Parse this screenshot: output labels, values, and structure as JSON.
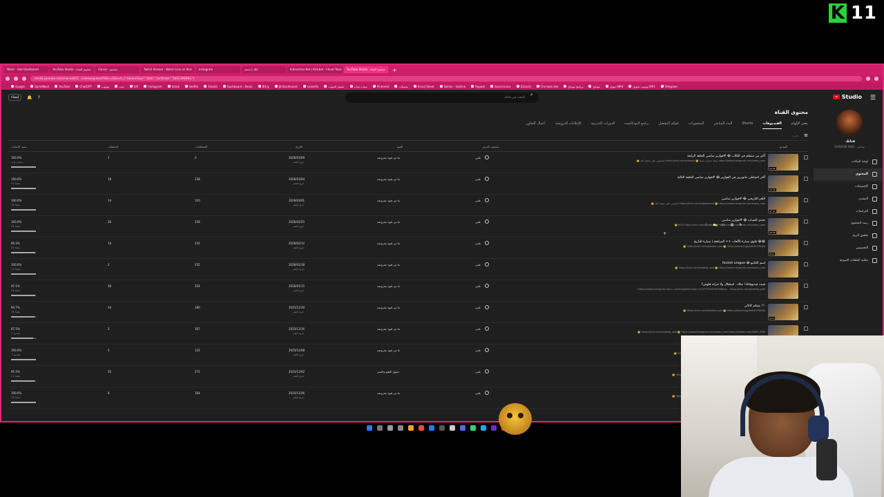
{
  "overlay": {
    "logo_letter": "K",
    "logo_number": "11"
  },
  "browser": {
    "tabs": [
      {
        "label": "Wizer - Slot Dashboard"
      },
      {
        "label": "YouTube Studio - محتوى القناة"
      },
      {
        "label": "Canva - تصاميم"
      },
      {
        "label": "Twitch Stream - Watch Live on Kick"
      },
      {
        "label": "Instagram"
      },
      {
        "label": "كلك | منصة"
      },
      {
        "label": "Interactive Bot | Kickbot - Cloud Tools"
      },
      {
        "label": "YouTube Studio - محتوى القناة"
      }
    ],
    "active_tab": 7,
    "new_tab": "+",
    "url": "studio.youtube.com/channel/UC.../videos/upload?filter=[]&sort={\"columnType\":\"date\",\"sortOrder\":\"DESCENDING\"}",
    "bookmarks": [
      "Google",
      "SprintNest",
      "YouTube",
      "ChatGPT",
      "يوتيوب",
      "بحث",
      "X/E",
      "Instagram",
      "tiktok",
      "Netflix",
      "Shahid",
      "Dashboard - Resto",
      "Bit.ly",
      "JB Dashboard",
      "Linkedin",
      "تحميل الصوت",
      "سناب شات",
      "Pinterest",
      "تحميلات",
      "Emoji Sheet",
      "Notion - Outline",
      "Repost",
      "Social Icons",
      "Discord",
      "The best site",
      "برنامج مونتاج",
      "مونتاج",
      "تحويل MP4",
      "يوتيوب تحويل MP3",
      "Telegram"
    ]
  },
  "studio": {
    "logo_text": "Studio",
    "search_placeholder": "البحث في قناتك",
    "create_label": "إنشاء",
    "page_title": "محتوى القناة",
    "tabs": [
      "بعض الإلهام",
      "الفيديوهات",
      "Shorts",
      "البث المباشر",
      "المنشورات",
      "قوائم التشغيل",
      "برامج البودكاست",
      "الدورات التدريبية",
      "الإعلانات الترويجية",
      "أعمال التعاون"
    ],
    "active_tab_index": 1,
    "filter_label": "فلترة",
    "columns": {
      "video": "الفيديو",
      "visibility": "مستوى العرض",
      "restrictions": "القيود",
      "date": "التاريخ",
      "views": "المشاهدات",
      "comments": "التعليقات",
      "likes": "نسبة الإعجاب"
    },
    "rows": [
      {
        "title": "أكثر من منتظم في الكلاب 😂 #فوازير ساسي الحلقة الرابعة",
        "desc": "👑 ادعموني على منصة كيك https://kick.com/shadow 👑 رابط حسابي انستا https://www.instagram.com/samy_swe",
        "duration": "22:22",
        "visibility": "علني",
        "restrictions": "ما من قيود مفروضة",
        "date": "2026/03/09",
        "date_sub": "تاريخ النشر",
        "views": "3",
        "comments": "1",
        "likes": "100.0%",
        "likes_sub": "معجب واحد",
        "likes_frac": 1.0
      },
      {
        "title": "أكثر احتياطي ماتويرين في الفوازير 😂 #فوازير ساسي الحلقة الثالثة",
        "desc": "",
        "duration": "43:20",
        "visibility": "علني",
        "restrictions": "ما من قيود مفروضة",
        "date": "2026/03/04",
        "date_sub": "تاريخ النشر",
        "views": "138",
        "comments": "18",
        "likes": "100.0%",
        "likes_sub": "31 معجبًا",
        "likes_frac": 1.0
      },
      {
        "title": "اللغز التاريخي 😂 #فوازير ساسي",
        "desc": "👑 ادعموني على منصة كيك https://kick.com/sakaemood 👑 https://www.instagram.com/samy_swe",
        "duration": "47:47",
        "visibility": "علني",
        "restrictions": "ما من قيود مفروضة",
        "date": "2026/03/01",
        "date_sub": "تاريخ النشر",
        "views": "120",
        "comments": "14",
        "likes": "100.0%",
        "likes_sub": "16 معجبًا",
        "likes_frac": 1.0
      },
      {
        "title": "تحدي الشباب 😂 #فوازير ساسي",
        "desc": "👑 KICK https://kick.com/shadow 👑 https://www.instagram.com/samy_swe",
        "duration": "49:09",
        "visibility": "علني",
        "restrictions": "ما من قيود مفروضة",
        "date": "2026/02/25",
        "date_sub": "تاريخ النشر",
        "views": "228",
        "comments": "26",
        "likes": "100.0%",
        "likes_sub": "32 معجبًا",
        "likes_frac": 1.0
      },
      {
        "title": "فلوق سيارة الألعاب ++ المرافقة | سيارة للتاريخ 😂😂",
        "desc": "👑 https://kick.com/shadow_swe 👑 https://discord.gg/Xeb4hTWkBq",
        "duration": "8:22",
        "visibility": "علني",
        "restrictions": "ما من قيود مفروضة",
        "date": "2026/02/12",
        "date_sub": "تاريخ النشر",
        "views": "235",
        "comments": "14",
        "likes": "96.3%",
        "likes_sub": "26 معجبًا",
        "likes_frac": 0.963
      },
      {
        "title": "Rocket League 😂 اسم الكانيو",
        "desc": "👑 https://kick.com/shadow_swe 👑 https://www.instagram.com/samy_swe",
        "duration": "",
        "visibility": "علني",
        "restrictions": "ما من قيود مفروضة",
        "date": "2026/01/18",
        "date_sub": "تاريخ النشر",
        "views": "235",
        "comments": "2",
        "likes": "100.0%",
        "likes_sub": "11 معجبًا",
        "likes_frac": 1.0
      },
      {
        "title": "قبيت فيديوهاتك! مكاد.. استقلال ولا خرابة قلوس؟",
        "desc": "https://www.instagram.com/...cenelcoparter?igsh=YLhYTZZZdhtZ9lb6eka... https://kick.com/shadow_swe",
        "duration": "",
        "visibility": "علني",
        "restrictions": "ما من قيود مفروضة",
        "date": "2026/01/15",
        "date_sub": "تاريخ النشر",
        "views": "224",
        "comments": "20",
        "likes": "97.1%",
        "likes_sub": "34 معجبًا",
        "likes_frac": 0.971
      },
      {
        "title": "شيكم كانالي 🖤",
        "desc": "👑 https://kick.com/shadow_swe 👑 https://discord.gg/Xeb4hTWkBq",
        "duration": "9:13",
        "visibility": "علني",
        "restrictions": "ما من قيود مفروضة",
        "date": "2025/12/30",
        "date_sub": "تاريخ النشر",
        "views": "180",
        "comments": "14",
        "likes": "94.7%",
        "likes_sub": "18 معجبًا",
        "likes_frac": 0.947
      },
      {
        "title": "",
        "desc": "👑 https://kick.com/shadow_swe 👑 https://www.instagram.com/samy_swe https://twitter.com/SAMY_SWE",
        "duration": "",
        "visibility": "علني",
        "restrictions": "ما من قيود مفروضة",
        "date": "2025/12/16",
        "date_sub": "تاريخ النشر",
        "views": "167",
        "comments": "2",
        "likes": "87.5%",
        "likes_sub": "7 معجبين",
        "likes_frac": 0.875
      },
      {
        "title": "",
        "desc": "👑 https://www.instagram.com/samy_swe 👑 https://twitter.com/SAMY_SWE",
        "duration": "",
        "visibility": "علني",
        "restrictions": "ما من قيود مفروضة",
        "date": "2025/12/08",
        "date_sub": "تاريخ النشر",
        "views": "122",
        "comments": "5",
        "likes": "100.0%",
        "likes_sub": "7 معجبين",
        "likes_frac": 1.0
      },
      {
        "title": "",
        "desc": "👑 https://www.instagram.com/samy_swe 👑 https://discord.gg/Xeb4hTWkBq",
        "duration": "",
        "visibility": "علني",
        "restrictions": "حقوق الطبع والنشر",
        "date": "2025/12/02",
        "date_sub": "تاريخ النشر",
        "views": "275",
        "comments": "20",
        "likes": "95.5%",
        "likes_sub": "21 معجبًا",
        "likes_frac": 0.955
      },
      {
        "title": "",
        "desc": "👑 https://www.instagram.com/samy_swe 👑 https://discord.gg/Xeb4hTWkBq",
        "duration": "",
        "visibility": "علني",
        "restrictions": "ما من قيود مفروضة",
        "date": "2025/11/26",
        "date_sub": "تاريخ النشر",
        "views": "164",
        "comments": "8",
        "likes": "100.0%",
        "likes_sub": "13 معجبًا",
        "likes_frac": 1.0
      }
    ],
    "sidebar": {
      "channel_label": "قناتك",
      "channel_handle": "SHADOW SWE - ساسي",
      "items": [
        "لوحة البيانات",
        "المحتوى",
        "الإحصاءات",
        "المنتدى",
        "الترجمات",
        "رصد المحتوى",
        "تحقيق الربح",
        "التخصيص",
        "مكتبة الملفات الصوتية"
      ],
      "active_index": 1
    }
  }
}
